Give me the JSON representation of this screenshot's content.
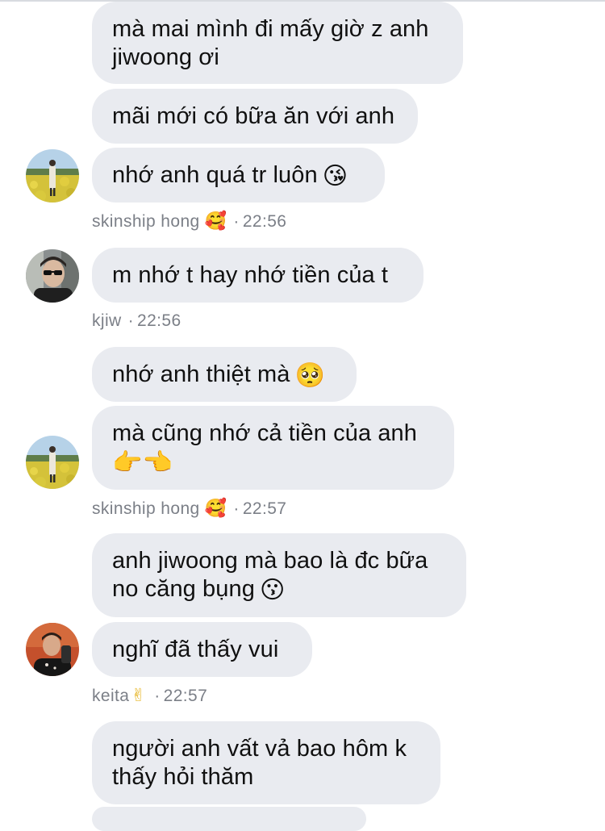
{
  "messages": [
    {
      "text": "mà mai mình đi mấy giờ z anh\njiwoong ơi",
      "emoji": ""
    },
    {
      "text": "mãi mới có bữa ăn với anh",
      "emoji": ""
    },
    {
      "text": "nhớ anh quá tr luôn",
      "emoji": "😘"
    },
    {
      "text": "m nhớ t hay nhớ tiền của t",
      "emoji": ""
    },
    {
      "text": "nhớ anh thiệt mà",
      "emoji": "🥺"
    },
    {
      "text": "mà cũng nhớ cả tiền của anh",
      "emoji": "👉👈"
    },
    {
      "text": "anh jiwoong mà bao là đc bữa\nno căng bụng",
      "emoji": "😗"
    },
    {
      "text": "nghĩ đã thấy vui",
      "emoji": ""
    },
    {
      "text": "người anh vất vả bao hôm k\nthấy hỏi thăm",
      "emoji": ""
    }
  ],
  "meta": [
    {
      "name": "skinship hong",
      "emoji": "🥰",
      "sep": "·",
      "time": "22:56"
    },
    {
      "name": "kjiw",
      "emoji": "",
      "sep": "·",
      "time": "22:56"
    },
    {
      "name": "skinship hong",
      "emoji": "🥰",
      "sep": "·",
      "time": "22:57"
    },
    {
      "name": "keita",
      "emoji": "✌",
      "sep": "·",
      "time": "22:57"
    }
  ],
  "colors": {
    "bubble_bg": "#e9ebf0",
    "meta_text": "#7b7f87",
    "divider": "#d8dbe0"
  }
}
